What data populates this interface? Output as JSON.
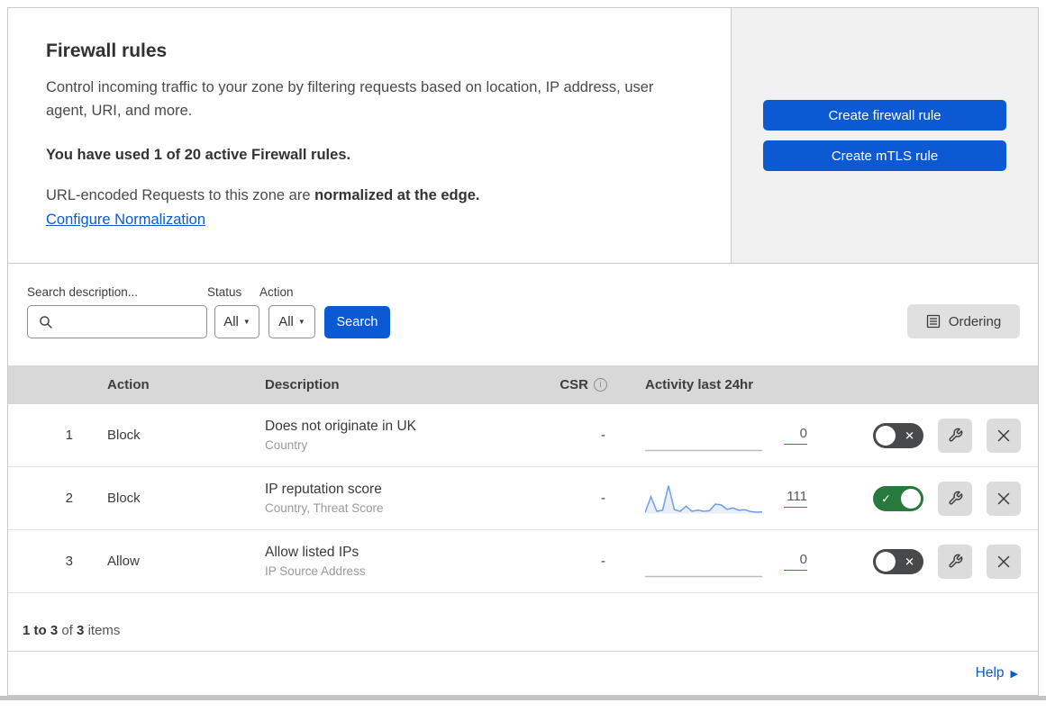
{
  "panel": {
    "title": "Firewall rules",
    "description": "Control incoming traffic to your zone by filtering requests based on location, IP address, user agent, URI, and more.",
    "usage_note": "You have used 1 of 20 active Firewall rules.",
    "normalization_text": "URL-encoded Requests to this zone are ",
    "normalization_bold": "normalized at the edge.",
    "normalization_link": "Configure Normalization",
    "create_firewall_button": "Create firewall rule",
    "create_mtls_button": "Create mTLS rule"
  },
  "filters": {
    "search_label": "Search description...",
    "status_label": "Status",
    "status_value": "All",
    "action_label": "Action",
    "action_value": "All",
    "search_button": "Search",
    "ordering_button": "Ordering"
  },
  "table": {
    "columns": {
      "action": "Action",
      "description": "Description",
      "csr": "CSR",
      "activity": "Activity last 24hr"
    },
    "rows": [
      {
        "index": "1",
        "action": "Block",
        "title": "Does not originate in UK",
        "subtitle": "Country",
        "csr": "-",
        "activity_count": "0",
        "enabled": false,
        "sparkline": []
      },
      {
        "index": "2",
        "action": "Block",
        "title": "IP reputation score",
        "subtitle": "Country, Threat Score",
        "csr": "-",
        "activity_count": "111",
        "enabled": true,
        "sparkline": [
          4,
          60,
          8,
          12,
          100,
          14,
          8,
          26,
          8,
          12,
          8,
          10,
          34,
          31,
          15,
          20,
          12,
          14,
          7,
          5,
          6
        ]
      },
      {
        "index": "3",
        "action": "Allow",
        "title": "Allow listed IPs",
        "subtitle": "IP Source Address",
        "csr": "-",
        "activity_count": "0",
        "enabled": false,
        "sparkline": []
      }
    ]
  },
  "footer": {
    "range": "1 to 3",
    "of_text": "of",
    "total": "3",
    "items_text": "items",
    "help_label": "Help"
  },
  "colors": {
    "accent_blue": "#0b5ad3",
    "toggle_on_green": "#27793e",
    "toggle_off_gray": "#48494b",
    "sparkline_blue": "#6f9ee8",
    "sparkline_fill": "#e9eef8",
    "flat_line_gray": "#bdbdbd"
  }
}
